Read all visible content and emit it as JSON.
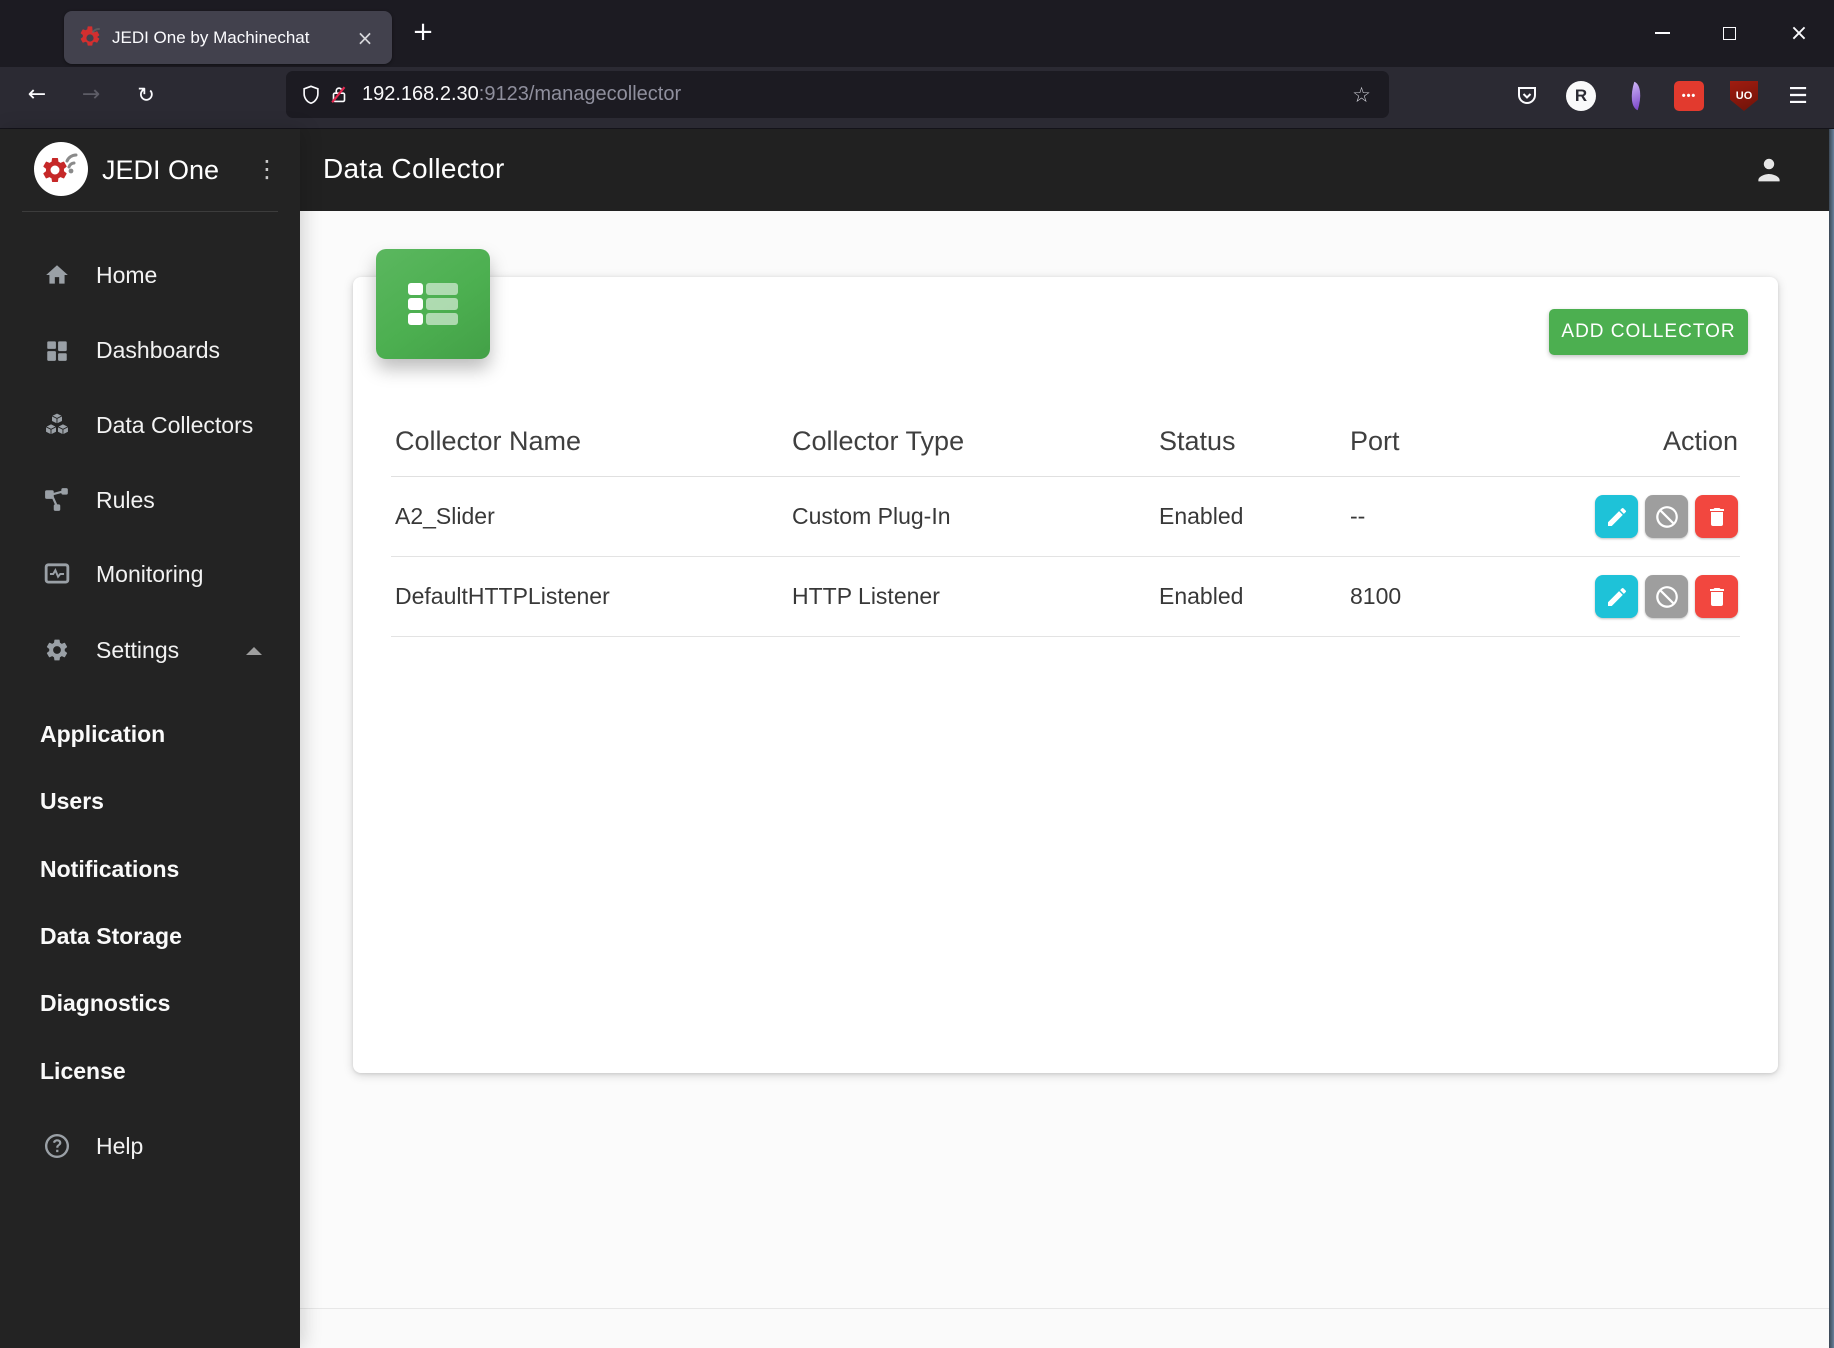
{
  "browser": {
    "tab_title": "JEDI One by Machinechat",
    "url_host": "192.168.2.30",
    "url_path": ":9123/managecollector",
    "ext_r_label": "R",
    "ext_ubo_label": "UO"
  },
  "glyphs": {
    "close": "×",
    "new_tab": "+",
    "back": "←",
    "forward": "→",
    "reload": "↻",
    "star": "☆",
    "kebab": "⋮",
    "hamburger": "☰",
    "lastpass_dots": "•••"
  },
  "sidebar": {
    "app_name": "JEDI One",
    "items": [
      {
        "label": "Home"
      },
      {
        "label": "Dashboards"
      },
      {
        "label": "Data Collectors"
      },
      {
        "label": "Rules"
      },
      {
        "label": "Monitoring"
      },
      {
        "label": "Settings"
      }
    ],
    "sub_items": [
      {
        "label": "Application"
      },
      {
        "label": "Users"
      },
      {
        "label": "Notifications"
      },
      {
        "label": "Data Storage"
      },
      {
        "label": "Diagnostics"
      },
      {
        "label": "License"
      }
    ],
    "help_label": "Help"
  },
  "header": {
    "title": "Data Collector"
  },
  "main": {
    "add_button_label": "ADD COLLECTOR",
    "table": {
      "columns": [
        "Collector Name",
        "Collector Type",
        "Status",
        "Port",
        "Action"
      ],
      "rows": [
        {
          "name": "A2_Slider",
          "type": "Custom Plug-In",
          "status": "Enabled",
          "port": "--"
        },
        {
          "name": "DefaultHTTPListener",
          "type": "HTTP Listener",
          "status": "Enabled",
          "port": "8100"
        }
      ]
    }
  },
  "colors": {
    "accent_green": "#4caf50",
    "edit_cyan": "#1ec2d8",
    "disable_gray": "#9e9e9e",
    "delete_red": "#f2473f",
    "sidebar_bg": "#232323",
    "appbar_bg": "#212121"
  }
}
